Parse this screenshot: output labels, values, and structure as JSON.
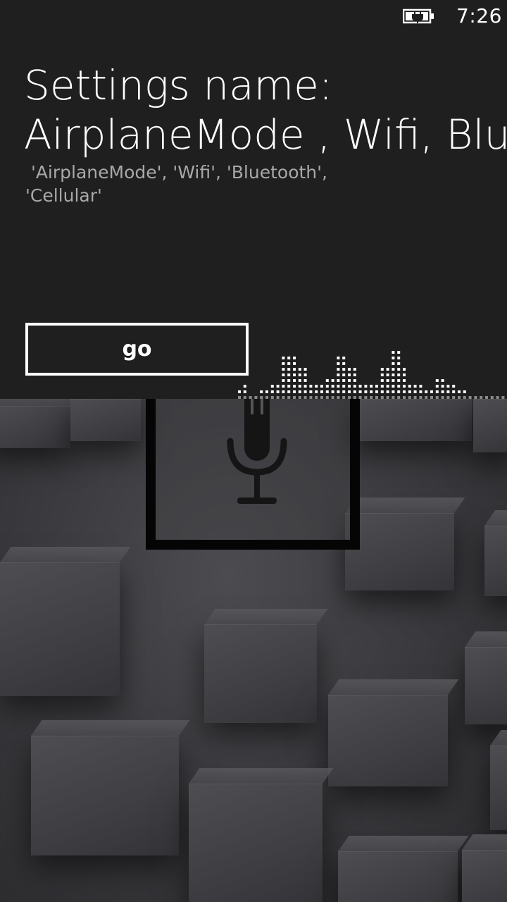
{
  "status_bar": {
    "time": "7:26",
    "battery_icon": "battery-charging-icon"
  },
  "main": {
    "title_line1": "Settings name:",
    "title_line2": "AirplaneMode , Wifi, Bluetooth , Cellular",
    "subtitle": " 'AirplaneMode', 'Wifi', 'Bluetooth',\n'Cellular'",
    "go_label": "go"
  },
  "voice": {
    "mic_icon": "microphone-icon",
    "equalizer_icon": "audio-level-equalizer"
  },
  "colors": {
    "panel_bg": "#1f1f1f",
    "text_primary": "#ffffff",
    "text_secondary": "#a8a8a8",
    "button_border": "#ffffff",
    "mic_frame": "#050505"
  }
}
